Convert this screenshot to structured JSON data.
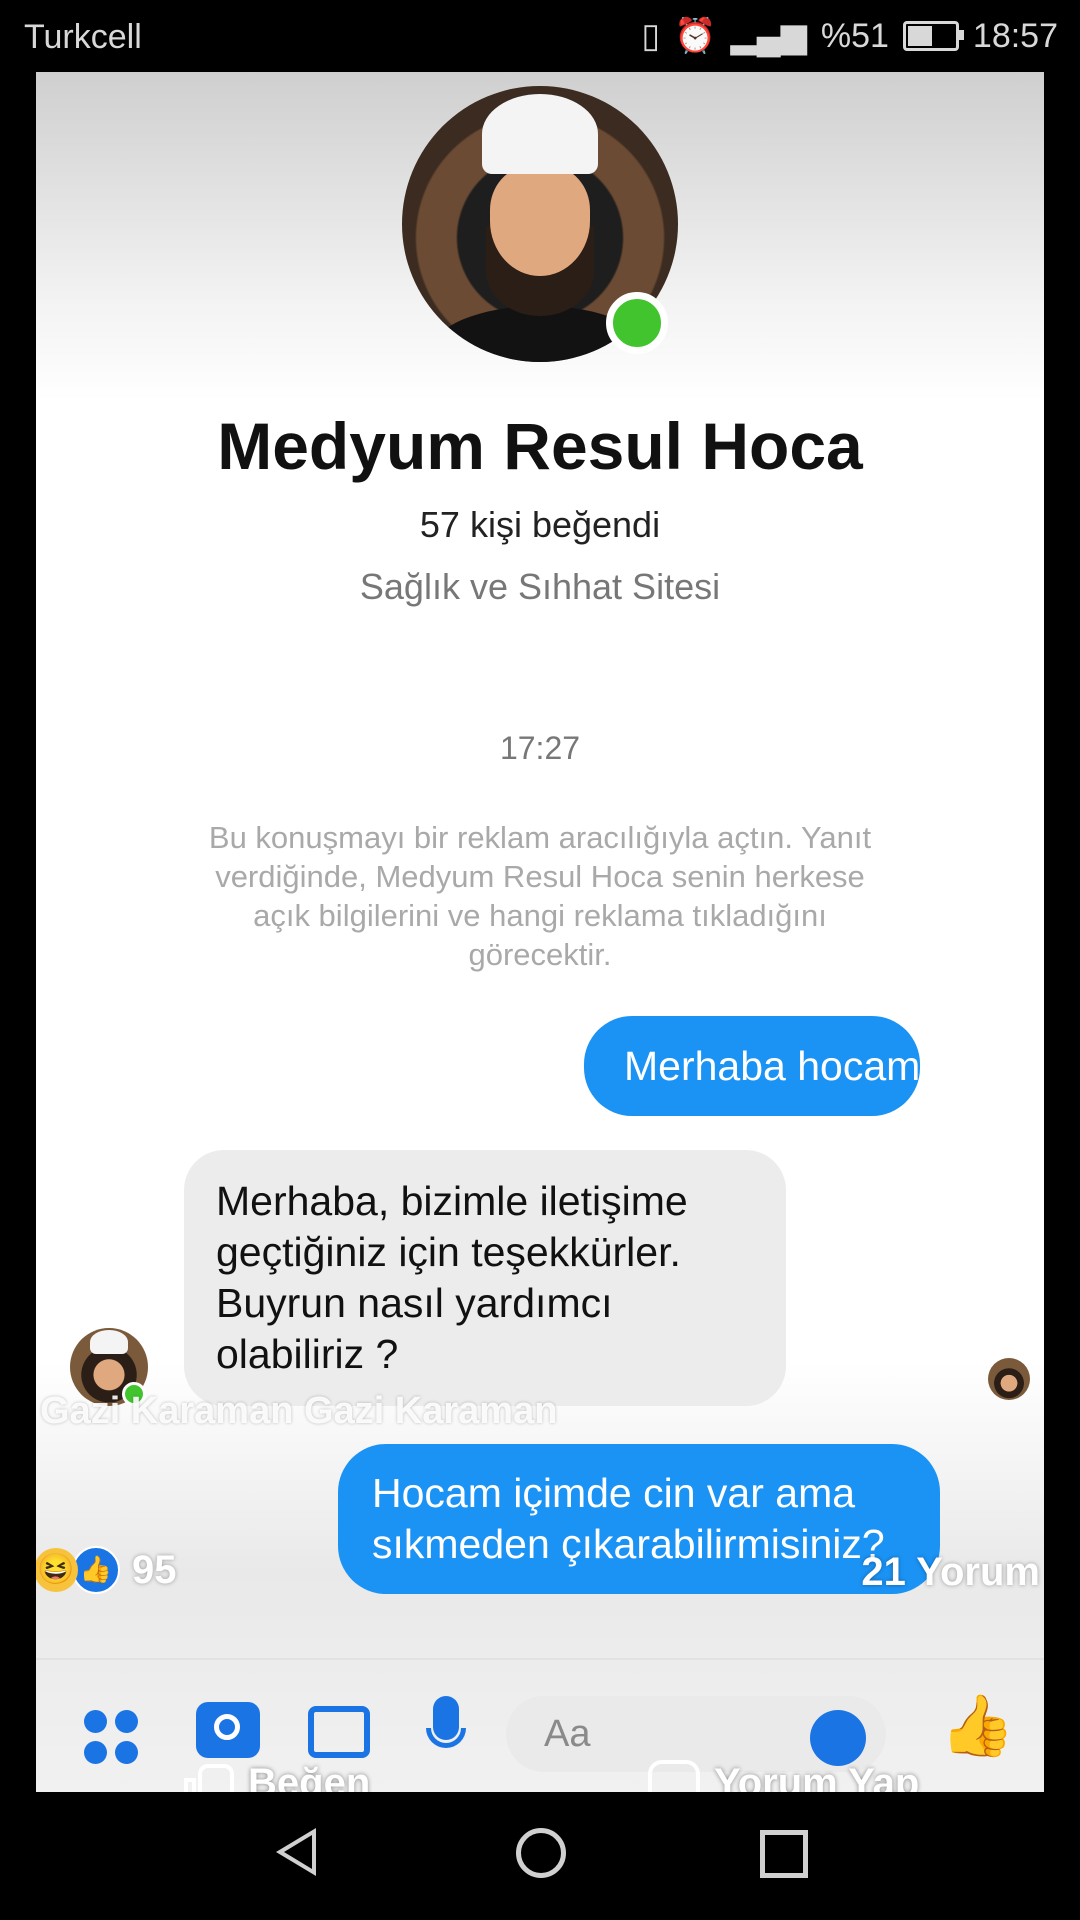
{
  "status_bar": {
    "carrier": "Turkcell",
    "battery_text": "%51",
    "battery_level": 0.51,
    "time": "18:57",
    "icons": [
      "vibrate-icon",
      "alarm-icon",
      "signal-icon",
      "battery-icon"
    ]
  },
  "chat": {
    "page_name": "Medyum Resul Hoca",
    "likes": "57 kişi beğendi",
    "category": "Sağlık ve Sıhhat Sitesi",
    "timestamp": "17:27",
    "notice": "Bu konuşmayı bir reklam aracılığıyla açtın. Yanıt verdiğinde, Medyum Resul Hoca senin herkese açık bilgilerini ve hangi reklama tıkladığını görecektir.",
    "messages": [
      {
        "from": "me",
        "text": "Merhaba hocam"
      },
      {
        "from": "page",
        "text": "Merhaba, bizimle iletişime geçtiğiniz için teşekkürler. Buyrun nasıl yardımcı olabiliriz ?"
      },
      {
        "from": "me",
        "text": "Hocam içimde cin var ama sıkmeden çıkarabilirmisiniz?"
      }
    ]
  },
  "composer": {
    "placeholder": "Aa",
    "icons": [
      "apps-icon",
      "camera-icon",
      "image-icon",
      "microphone-icon",
      "emoji-icon",
      "thumbs-up-icon"
    ]
  },
  "facebook_overlay": {
    "watermark": "Gazi Karaman Gazi Karaman",
    "reaction_count": "95",
    "comment_count": "21 Yorum",
    "like_label": "Beğen",
    "comment_label": "Yorum Yap",
    "accent_color": "#1b93f5",
    "online_color": "#42c42f"
  },
  "nav_bar": {
    "icons": [
      "back-icon",
      "home-icon",
      "recent-apps-icon"
    ]
  }
}
